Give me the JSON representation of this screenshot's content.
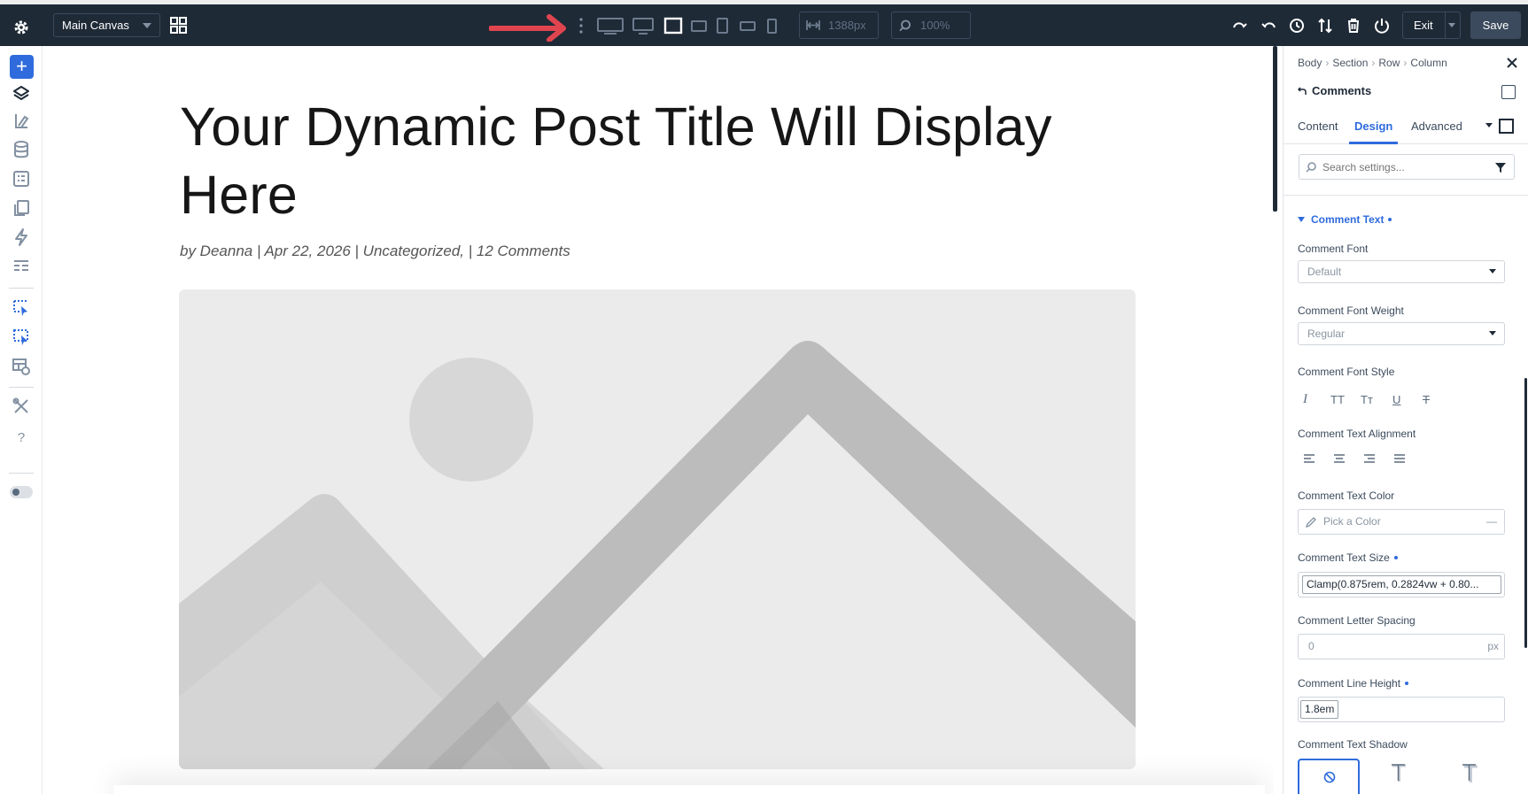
{
  "toolbar": {
    "canvas_label": "Main Canvas",
    "width_value": "1388px",
    "zoom_value": "100%",
    "exit_label": "Exit",
    "save_label": "Save"
  },
  "post": {
    "title": "Your Dynamic Post Title Will Display Here",
    "meta": "by Deanna | Apr 22, 2026 | Uncategorized, | 12 Comments"
  },
  "panel": {
    "breadcrumbs": [
      "Body",
      "Section",
      "Row",
      "Column"
    ],
    "module_title": "Comments",
    "tabs": [
      "Content",
      "Design",
      "Advanced"
    ],
    "active_tab": "Design",
    "search_placeholder": "Search settings...",
    "group_title": "Comment Text",
    "fields": {
      "font_label": "Comment Font",
      "font_value": "Default",
      "weight_label": "Comment Font Weight",
      "weight_value": "Regular",
      "style_label": "Comment Font Style",
      "style_options": [
        "I",
        "TT",
        "Tт",
        "U",
        "T"
      ],
      "align_label": "Comment Text Alignment",
      "color_label": "Comment Text Color",
      "color_placeholder": "Pick a Color",
      "color_value": "—",
      "size_label": "Comment Text Size",
      "size_value": "Clamp(0.875rem, 0.2824vw + 0.80...",
      "spacing_label": "Comment Letter Spacing",
      "spacing_value": "0",
      "spacing_unit": "px",
      "lineheight_label": "Comment Line Height",
      "lineheight_value": "1.8em",
      "shadow_label": "Comment Text Shadow"
    }
  },
  "colors": {
    "toolbar_bg": "#1f2a37",
    "accent": "#2f6bdc",
    "annotation_arrow": "#e0454f"
  }
}
